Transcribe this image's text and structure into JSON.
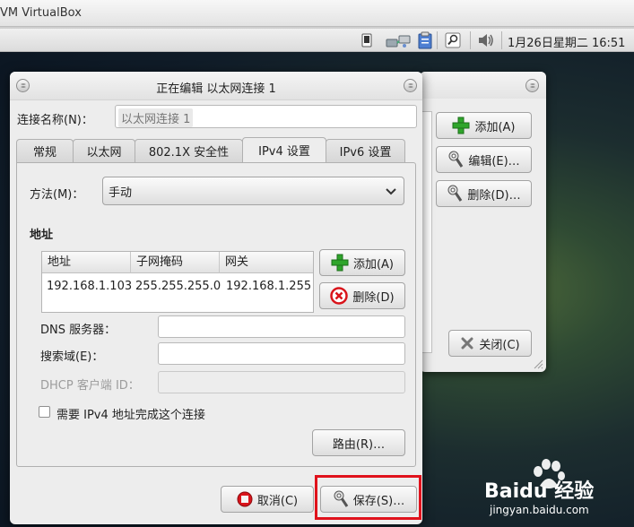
{
  "host": {
    "title": "VM VirtualBox"
  },
  "panel": {
    "clock": "1月26日星期二 16:51",
    "icons": [
      "screen-icon",
      "network-icon",
      "clipboard-icon",
      "search-icon",
      "volume-icon"
    ]
  },
  "dialog": {
    "title": "正在编辑 以太网连接 1",
    "conn_name_label": "连接名称(N)：",
    "conn_name_value": "以太网连接 1",
    "tabs": [
      "常规",
      "以太网",
      "802.1X 安全性",
      "IPv4 设置",
      "IPv6 设置"
    ],
    "active_tab": "IPv4 设置",
    "method_label": "方法(M)：",
    "method_value": "手动",
    "address_section": "地址",
    "table": {
      "headers": [
        "地址",
        "子网掩码",
        "网关"
      ],
      "rows": [
        [
          "192.168.1.103",
          "255.255.255.0",
          "192.168.1.255"
        ]
      ]
    },
    "add_label": "添加(A)",
    "delete_label": "删除(D)",
    "dns_label": "DNS 服务器：",
    "search_domain_label": "搜索域(E)：",
    "dhcp_label": "DHCP 客户端 ID：",
    "require_ipv4_label": "需要 IPv4 地址完成这个连接",
    "require_ipv4_checked": false,
    "routes_label": "路由(R)…",
    "cancel_label": "取消(C)",
    "save_label": "保存(S)…"
  },
  "bg_dialog": {
    "add_label": "添加(A)",
    "edit_label": "编辑(E)…",
    "delete_label": "删除(D)…",
    "close_label": "关闭(C)"
  },
  "watermark": {
    "brand": "Baidu 经验",
    "url": "jingyan.baidu.com"
  },
  "colors": {
    "highlight": "#e0121c",
    "add_green": "#2fa52b",
    "cancel_red": "#d9141b"
  }
}
